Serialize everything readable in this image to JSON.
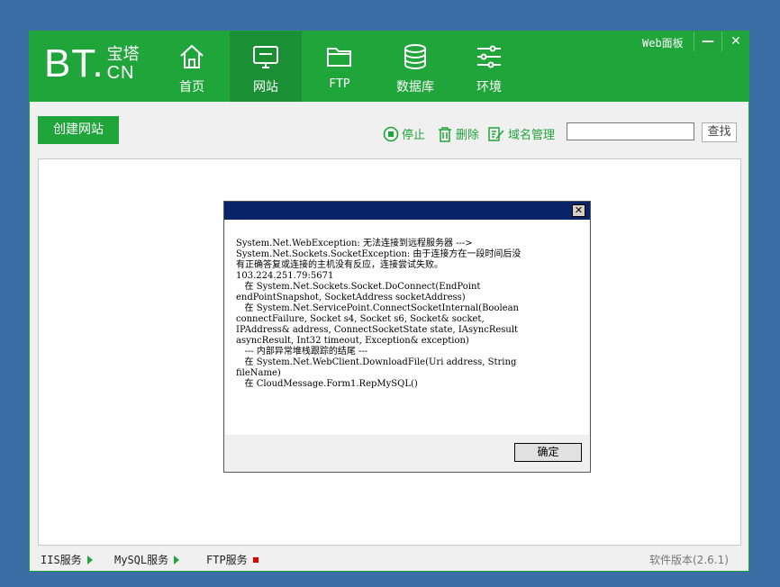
{
  "logo": {
    "main": "BT.",
    "cn_top": "宝塔",
    "cn_bottom": "CN"
  },
  "nav": [
    {
      "label": "首页",
      "icon": "home-icon"
    },
    {
      "label": "网站",
      "icon": "monitor-icon",
      "active": true
    },
    {
      "label": "FTP",
      "icon": "folder-icon"
    },
    {
      "label": "数据库",
      "icon": "database-icon"
    },
    {
      "label": "环境",
      "icon": "sliders-icon"
    }
  ],
  "window": {
    "web_panel": "Web面板",
    "minimize": "—",
    "close": "✕"
  },
  "toolbar": {
    "create_site": "创建网站",
    "stop": "停止",
    "delete": "删除",
    "domain_manage": "域名管理",
    "search_value": "",
    "search_button": "查找"
  },
  "status_bar": {
    "iis": "IIS服务",
    "mysql": "MySQL服务",
    "ftp": "FTP服务",
    "version": "软件版本(2.6.1)"
  },
  "dialog": {
    "close": "✕",
    "message": "System.Net.WebException: 无法连接到远程服务器 --->\nSystem.Net.Sockets.SocketException: 由于连接方在一段时间后没\n有正确答复或连接的主机没有反应，连接尝试失败。\n103.224.251.79:5671\n   在 System.Net.Sockets.Socket.DoConnect(EndPoint\nendPointSnapshot, SocketAddress socketAddress)\n   在 System.Net.ServicePoint.ConnectSocketInternal(Boolean\nconnectFailure, Socket s4, Socket s6, Socket& socket,\nIPAddress& address, ConnectSocketState state, IAsyncResult\nasyncResult, Int32 timeout, Exception& exception)\n   --- 内部异常堆栈跟踪的结尾 ---\n   在 System.Net.WebClient.DownloadFile(Uri address, String\nfileName)\n   在 CloudMessage.Form1.RepMySQL()",
    "ok": "确定"
  },
  "colors": {
    "brand_green": "#20a53a",
    "active_green": "#1b8f33",
    "desktop_blue": "#3a6ea5",
    "stopped_red": "#e00000",
    "dialog_title": "#0a246a"
  }
}
